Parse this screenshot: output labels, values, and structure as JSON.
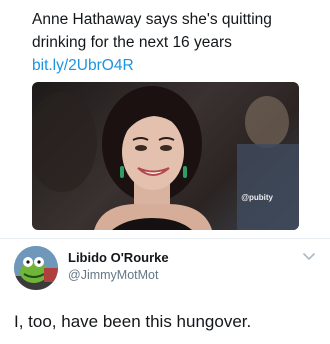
{
  "quoted_tweet": {
    "text": "Anne Hathaway says she's quitting drinking for the next 16 years",
    "link": "bit.ly/2UbrO4R",
    "watermark": "@pubity"
  },
  "reply": {
    "display_name": "Libido O'Rourke",
    "handle": "@JimmyMotMot",
    "text": "I, too, have been this hungover."
  },
  "icons": {
    "avatar": "kermit-avatar",
    "menu": "chevron-down-icon"
  },
  "colors": {
    "link": "#1b95e0",
    "secondary_text": "#657786",
    "primary_text": "#14171a"
  }
}
